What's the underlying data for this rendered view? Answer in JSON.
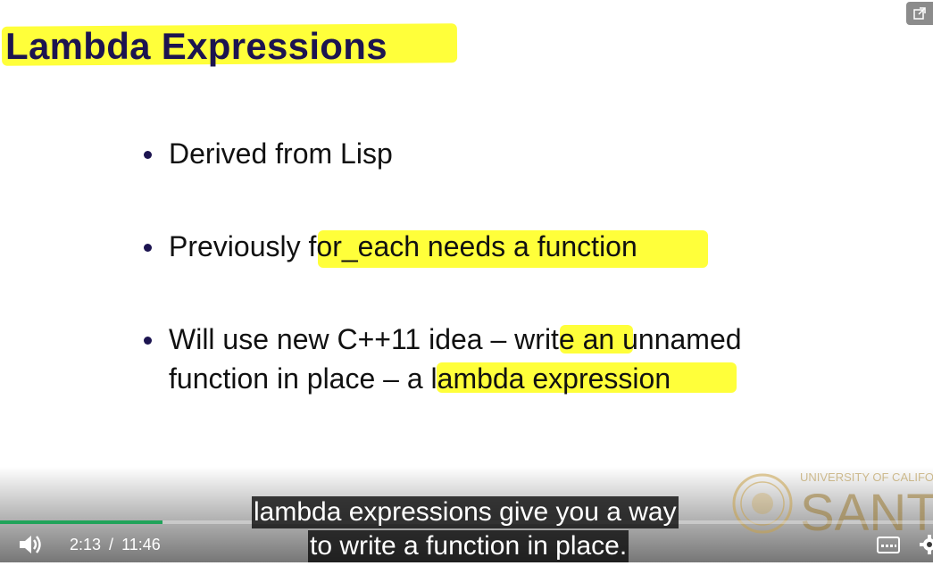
{
  "slide": {
    "title": "Lambda Expressions",
    "bullets": [
      {
        "plain": "Derived from Lisp"
      },
      {
        "plain": "Previously ",
        "highlight": "for_each needs a function"
      },
      {
        "line1_a": "Will use new C++11 idea – ",
        "line1_hl": "write",
        "line1_b": " an unnamed",
        "line2_a": "function in place – ",
        "line2_hl": "a lambda expression"
      }
    ],
    "highlight_color": "#ffff3a",
    "logo_text_top": "UNIVERSITY OF CALIFO",
    "logo_text_bottom": "SANTA CR"
  },
  "captions": {
    "line1": "lambda expressions give you a way",
    "line2": "to write a function in place."
  },
  "player": {
    "current_time": "2:13",
    "separator": "/",
    "duration": "11:46",
    "progress_fraction": 0.174,
    "progress_color": "#21a35a",
    "icons": {
      "share": "share-icon",
      "volume": "volume-icon",
      "captions": "captions-icon",
      "settings": "settings-icon"
    }
  }
}
